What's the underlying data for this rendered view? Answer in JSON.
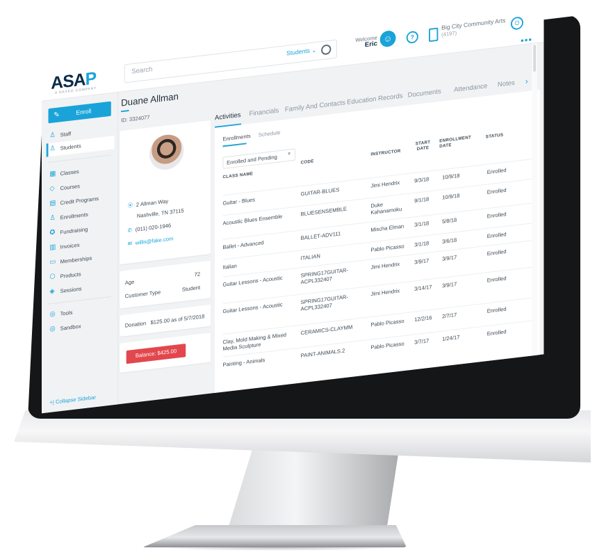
{
  "header": {
    "logo": "ASAP",
    "logo_sub": "A DAXKO COMPANY",
    "search_placeholder": "Search",
    "search_scope": "Students",
    "welcome_label": "Welcome",
    "welcome_name": "Eric",
    "org_name": "Big City Community Arts",
    "org_id": "(4197)"
  },
  "sidebar": {
    "enroll_label": "Enroll",
    "items": [
      {
        "label": "Staff",
        "icon": "person-icon"
      },
      {
        "label": "Students",
        "icon": "person-icon"
      },
      {
        "label": "Classes",
        "icon": "calendar-icon"
      },
      {
        "label": "Courses",
        "icon": "graduation-icon"
      },
      {
        "label": "Credit Programs",
        "icon": "document-icon"
      },
      {
        "label": "Enrollments",
        "icon": "person-icon"
      },
      {
        "label": "Fundraising",
        "icon": "gift-icon"
      },
      {
        "label": "Invoices",
        "icon": "invoice-icon"
      },
      {
        "label": "Memberships",
        "icon": "card-icon"
      },
      {
        "label": "Products",
        "icon": "box-icon"
      },
      {
        "label": "Sessions",
        "icon": "tag-icon"
      },
      {
        "label": "Tools",
        "icon": "wrench-icon"
      },
      {
        "label": "Sandbox",
        "icon": "sandbox-icon"
      }
    ],
    "collapse_label": "Collapse Sidebar"
  },
  "profile": {
    "name": "Duane Allman",
    "id": "ID: 3324077",
    "address1": "2 Allman Way",
    "address2": "Nashville, TN 37115",
    "phone": "(011) 020-1946",
    "email": "willis@fake.com",
    "age_label": "Age",
    "age_value": "72",
    "type_label": "Customer Type",
    "type_value": "Student",
    "donation_label": "Donation",
    "donation_value": "$125.00 as of 5/7/2018",
    "balance": "Balance: $425.00"
  },
  "tabs": [
    "Activities",
    "Financials",
    "Family And Contacts",
    "Education Records",
    "Documents",
    "Attendance",
    "Notes"
  ],
  "subtabs": [
    "Enrollments",
    "Schedule"
  ],
  "filter_value": "Enrolled and Pending",
  "table": {
    "headers": {
      "class_name": "CLASS NAME",
      "code": "CODE",
      "instructor": "INSTRUCTOR",
      "start_date": "START DATE",
      "enrollment_date": "ENROLLMENT DATE",
      "status": "STATUS"
    },
    "rows": [
      {
        "class_name": "Guitar - Blues",
        "code": "GUITAR-BLUES",
        "instructor": "Jimi Hendrix",
        "start": "9/3/18",
        "enrolled": "10/9/18",
        "status": "Enrolled"
      },
      {
        "class_name": "Acoustic Blues Ensemble",
        "code": "BLUESENSEMBLE",
        "instructor": "Duke Kahanamoku",
        "start": "9/1/18",
        "enrolled": "10/9/18",
        "status": "Enrolled"
      },
      {
        "class_name": "Ballet - Advanced",
        "code": "BALLET-ADV111",
        "instructor": "Mischa Elman",
        "start": "3/1/18",
        "enrolled": "5/8/18",
        "status": "Enrolled"
      },
      {
        "class_name": "Italian",
        "code": "ITALIAN",
        "instructor": "Pablo Picasso",
        "start": "3/1/18",
        "enrolled": "3/6/18",
        "status": "Enrolled"
      },
      {
        "class_name": "Guitar Lessons - Acoustic",
        "code": "SPRING17GUITAR-ACPL332407",
        "instructor": "Jimi Hendrix",
        "start": "3/9/17",
        "enrolled": "3/9/17",
        "status": "Enrolled"
      },
      {
        "class_name": "Guitar Lessons - Acoustic",
        "code": "SPRING17GUITAR-ACPL332407",
        "instructor": "Jimi Hendrix",
        "start": "3/14/17",
        "enrolled": "3/9/17",
        "status": "Enrolled"
      },
      {
        "class_name": "Clay, Mold Making & Mixed Media Sculpture",
        "code": "CERAMICS-CLAYMM",
        "instructor": "Pablo Picasso",
        "start": "12/2/16",
        "enrolled": "2/7/17",
        "status": "Enrolled"
      },
      {
        "class_name": "Painting - Animals",
        "code": "PAINT-ANIMALS.2",
        "instructor": "Pablo Picasso",
        "start": "3/7/17",
        "enrolled": "1/24/17",
        "status": "Enrolled"
      }
    ]
  },
  "colors": {
    "accent": "#1aa3d9",
    "balance": "#e2474d",
    "navy": "#0b2b4a"
  }
}
